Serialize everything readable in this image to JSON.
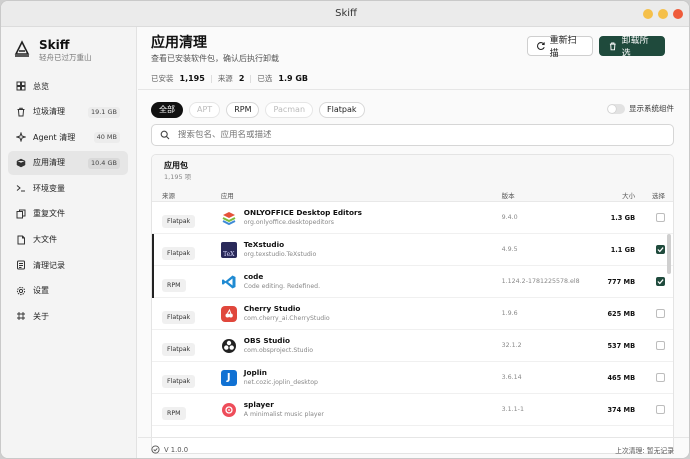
{
  "window": {
    "title": "Skiff",
    "controls_colors": [
      "#f5c04a",
      "#f5c04a",
      "#ef5b3a"
    ]
  },
  "brand": {
    "name": "Skiff",
    "tagline": "轻舟已过万重山"
  },
  "sidebar": {
    "items": [
      {
        "label": "总览",
        "icon": "overview-icon",
        "badge": ""
      },
      {
        "label": "垃圾清理",
        "icon": "trash-icon",
        "badge": "19.1 GB"
      },
      {
        "label": "Agent 清理",
        "icon": "agent-icon",
        "badge": "40 MB"
      },
      {
        "label": "应用清理",
        "icon": "package-icon",
        "badge": "10.4 GB"
      },
      {
        "label": "环境变量",
        "icon": "terminal-icon",
        "badge": ""
      },
      {
        "label": "重复文件",
        "icon": "copy-icon",
        "badge": ""
      },
      {
        "label": "大文件",
        "icon": "file-icon",
        "badge": ""
      },
      {
        "label": "清理记录",
        "icon": "history-icon",
        "badge": ""
      },
      {
        "label": "设置",
        "icon": "gear-icon",
        "badge": ""
      },
      {
        "label": "关于",
        "icon": "info-icon",
        "badge": ""
      }
    ],
    "active_index": 3
  },
  "header": {
    "title": "应用清理",
    "subtitle": "查看已安装软件包，确认后执行卸载",
    "rescan_label": "重新扫描",
    "uninstall_label": "卸载所选"
  },
  "stats": {
    "installed_label": "已安装",
    "installed_value": "1,195",
    "sources_label": "来源",
    "sources_value": "2",
    "selected_label": "已选",
    "selected_value": "1.9 GB"
  },
  "filters": {
    "chips": [
      {
        "label": "全部",
        "state": "active"
      },
      {
        "label": "APT",
        "state": "disabled"
      },
      {
        "label": "RPM",
        "state": "normal"
      },
      {
        "label": "Pacman",
        "state": "disabled"
      },
      {
        "label": "Flatpak",
        "state": "normal"
      }
    ],
    "show_system_label": "显示系统组件",
    "show_system_on": false
  },
  "search": {
    "placeholder": "搜索包名、应用名或描述",
    "value": ""
  },
  "table": {
    "title": "应用包",
    "count": "1,195 项",
    "columns": {
      "source": "来源",
      "app": "应用",
      "version": "版本",
      "size": "大小",
      "select": "选择"
    },
    "rows": [
      {
        "source": "Flatpak",
        "name": "ONLYOFFICE Desktop Editors",
        "id": "org.onlyoffice.desktopeditors",
        "version": "9.4.0",
        "size": "1.3 GB",
        "checked": false,
        "icon": "onlyoffice-icon"
      },
      {
        "source": "Flatpak",
        "name": "TeXstudio",
        "id": "org.texstudio.TeXstudio",
        "version": "4.9.5",
        "size": "1.1 GB",
        "checked": true,
        "icon": "texstudio-icon"
      },
      {
        "source": "RPM",
        "name": "code",
        "id": "Code editing. Redefined.",
        "version": "1.124.2-1781225578.el8",
        "size": "777 MB",
        "checked": true,
        "icon": "vscode-icon"
      },
      {
        "source": "Flatpak",
        "name": "Cherry Studio",
        "id": "com.cherry_ai.CherryStudio",
        "version": "1.9.6",
        "size": "625 MB",
        "checked": false,
        "icon": "cherry-studio-icon"
      },
      {
        "source": "Flatpak",
        "name": "OBS Studio",
        "id": "com.obsproject.Studio",
        "version": "32.1.2",
        "size": "537 MB",
        "checked": false,
        "icon": "obs-icon"
      },
      {
        "source": "Flatpak",
        "name": "Joplin",
        "id": "net.cozic.joplin_desktop",
        "version": "3.6.14",
        "size": "465 MB",
        "checked": false,
        "icon": "joplin-icon"
      },
      {
        "source": "RPM",
        "name": "splayer",
        "id": "A minimalist music player",
        "version": "3.1.1-1",
        "size": "374 MB",
        "checked": false,
        "icon": "splayer-icon"
      }
    ]
  },
  "footer": {
    "version": "V 1.0.0",
    "last_clean_label": "上次清理: 暂无记录"
  },
  "colors": {
    "accent": "#1f4a3c",
    "active_chip": "#111111"
  }
}
